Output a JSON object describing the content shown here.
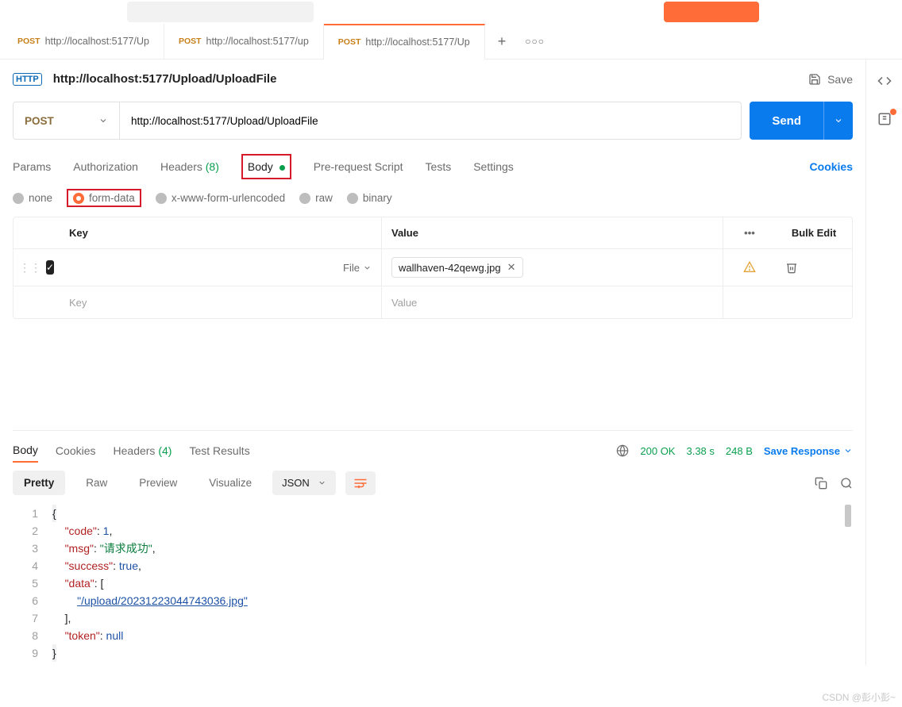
{
  "tabs": [
    {
      "method": "POST",
      "label": "http://localhost:5177/Up"
    },
    {
      "method": "POST",
      "label": "http://localhost:5177/up"
    },
    {
      "method": "POST",
      "label": "http://localhost:5177/Up"
    }
  ],
  "title": {
    "badge": "HTTP",
    "text": "http://localhost:5177/Upload/UploadFile",
    "save": "Save"
  },
  "request": {
    "method": "POST",
    "url": "http://localhost:5177/Upload/UploadFile",
    "send": "Send"
  },
  "reqTabs": {
    "params": "Params",
    "auth": "Authorization",
    "headers": "Headers",
    "headersCount": "(8)",
    "body": "Body",
    "prereq": "Pre-request Script",
    "tests": "Tests",
    "settings": "Settings",
    "cookies": "Cookies"
  },
  "bodyTypes": {
    "none": "none",
    "formdata": "form-data",
    "xwww": "x-www-form-urlencoded",
    "raw": "raw",
    "binary": "binary"
  },
  "table": {
    "keyHeader": "Key",
    "valueHeader": "Value",
    "bulkEdit": "Bulk Edit",
    "fileType": "File",
    "fileName": "wallhaven-42qewg.jpg",
    "keyPlaceholder": "Key",
    "valuePlaceholder": "Value"
  },
  "response": {
    "tabs": {
      "body": "Body",
      "cookies": "Cookies",
      "headers": "Headers",
      "headersCount": "(4)",
      "tests": "Test Results"
    },
    "status": "200 OK",
    "time": "3.38 s",
    "size": "248 B",
    "saveResponse": "Save Response"
  },
  "viewRow": {
    "pretty": "Pretty",
    "raw": "Raw",
    "preview": "Preview",
    "visualize": "Visualize",
    "format": "JSON"
  },
  "json": {
    "l1": "{",
    "l2_key": "\"code\"",
    "l2_val": "1",
    "l3_key": "\"msg\"",
    "l3_val": "\"请求成功\"",
    "l4_key": "\"success\"",
    "l4_val": "true",
    "l5_key": "\"data\"",
    "l6_val": "\"/upload/20231223044743036.jpg\"",
    "l8_key": "\"token\"",
    "l8_val": "null",
    "l9": "}"
  },
  "watermark": "CSDN @彭小彭~"
}
